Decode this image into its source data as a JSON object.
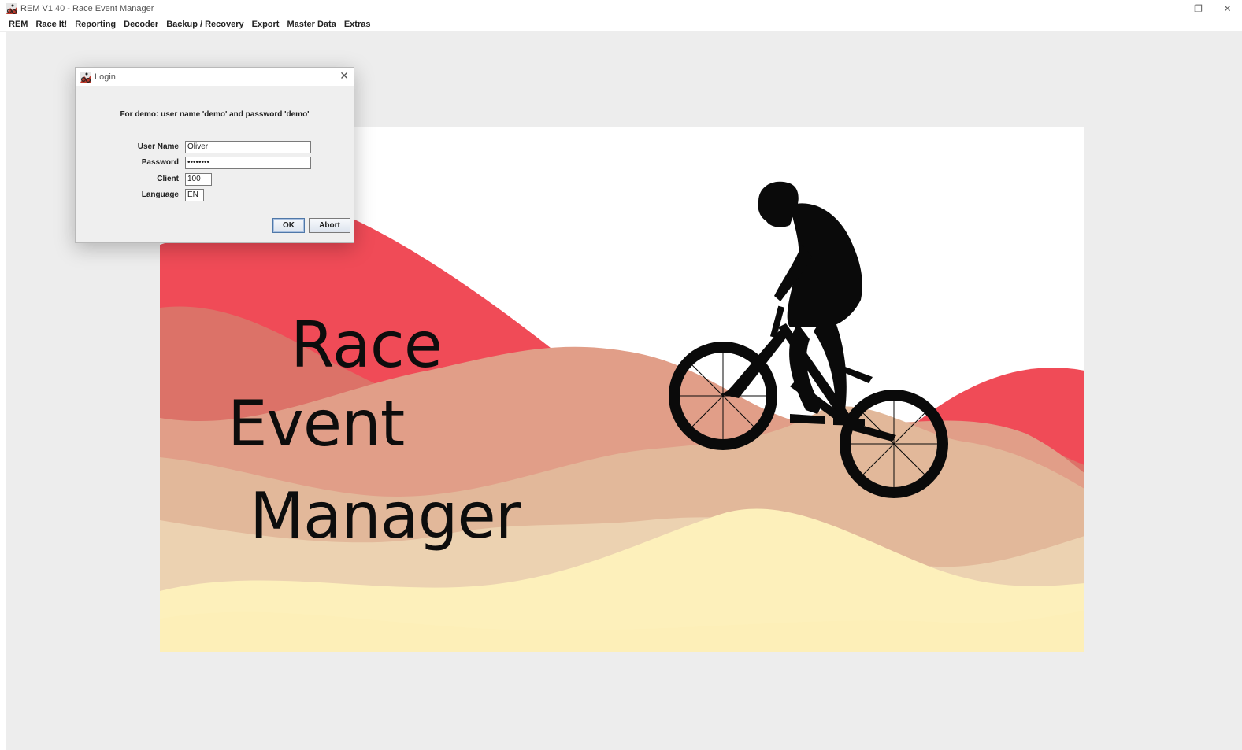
{
  "window": {
    "title": "REM V1.40 - Race Event Manager",
    "controls": {
      "minimize": "—",
      "restore": "❐",
      "close": "✕"
    }
  },
  "menubar": {
    "items": [
      "REM",
      "Race It!",
      "Reporting",
      "Decoder",
      "Backup / Recovery",
      "Export",
      "Master Data",
      "Extras"
    ]
  },
  "splash": {
    "line1": "Race",
    "line2": "Event",
    "line3": "Manager",
    "colors": {
      "red": "#f04b57",
      "rose": "#dc7268",
      "salmon": "#e19e88",
      "tan": "#e2b89a",
      "sand": "#ecd2b1",
      "cream": "#fdf0bb"
    }
  },
  "login": {
    "title": "Login",
    "close": "✕",
    "hint": "For demo: user name 'demo' and password 'demo'",
    "fields": {
      "username": {
        "label": "User Name",
        "value": "Oliver"
      },
      "password": {
        "label": "Password",
        "value": "••••••••"
      },
      "client": {
        "label": "Client",
        "value": "100"
      },
      "language": {
        "label": "Language",
        "value": "EN"
      }
    },
    "buttons": {
      "ok": "OK",
      "abort": "Abort"
    }
  }
}
